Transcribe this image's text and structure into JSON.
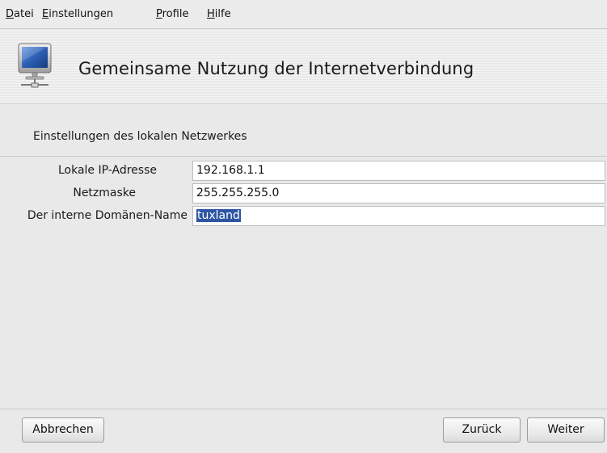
{
  "menu": {
    "items": [
      {
        "label": "Datei",
        "accel": "D",
        "rest": "atei"
      },
      {
        "label": "Einstellungen",
        "accel": "E",
        "rest": "instellungen"
      },
      {
        "label": "Profile",
        "accel": "P",
        "rest": "rofile"
      },
      {
        "label": "Hilfe",
        "accel": "H",
        "rest": "ilfe"
      }
    ]
  },
  "banner": {
    "title": "Gemeinsame Nutzung der Internetverbindung",
    "icon": "network-computer-icon"
  },
  "section": {
    "title": "Einstellungen des lokalen Netzwerkes"
  },
  "form": {
    "ip_label": "Lokale IP-Adresse",
    "ip_value": "192.168.1.1",
    "netmask_label": "Netzmaske",
    "netmask_value": "255.255.255.0",
    "domain_label": "Der interne Domänen-Name",
    "domain_value": "tuxland"
  },
  "buttons": {
    "cancel": "Abbrechen",
    "back": "Zurück",
    "next": "Weiter"
  },
  "colors": {
    "background": "#e9e9e9",
    "selection": "#2f55a4",
    "monitor_screen": "#2c5fb3"
  }
}
